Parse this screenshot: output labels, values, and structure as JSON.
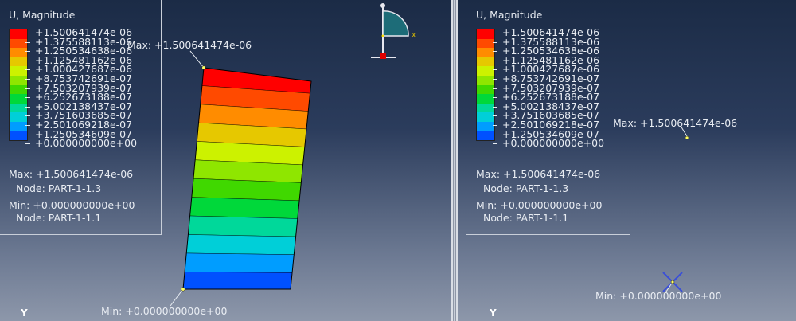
{
  "legend": {
    "title": "U, Magnitude",
    "values": [
      "+1.500641474e-06",
      "+1.375588113e-06",
      "+1.250534638e-06",
      "+1.125481162e-06",
      "+1.000427687e-06",
      "+8.753742691e-07",
      "+7.503207939e-07",
      "+6.252673188e-07",
      "+5.002138437e-07",
      "+3.751603685e-07",
      "+2.501069218e-07",
      "+1.250534609e-07",
      "+0.000000000e+00"
    ],
    "colors": [
      "#ff0000",
      "#ff4a00",
      "#ff8c00",
      "#e6c800",
      "#ccf200",
      "#8fe600",
      "#40d800",
      "#00d83a",
      "#00d89a",
      "#00cfd8",
      "#009dff",
      "#0051ff",
      "#0000f0"
    ],
    "max_line": "Max: +1.500641474e-06",
    "max_node": "Node: PART-1-1.3",
    "min_line": "Min: +0.000000000e+00",
    "min_node": "Node: PART-1-1.1"
  },
  "left_viewport": {
    "max_label": "Max: +1.500641474e-06",
    "min_label": "Min: +0.000000000e+00",
    "axis_label": "Y",
    "triad_axis_x": "X"
  },
  "right_viewport": {
    "max_label": "Max: +1.500641474e-06",
    "min_label": "Min: +0.000000000e+00",
    "axis_label": "Y"
  }
}
